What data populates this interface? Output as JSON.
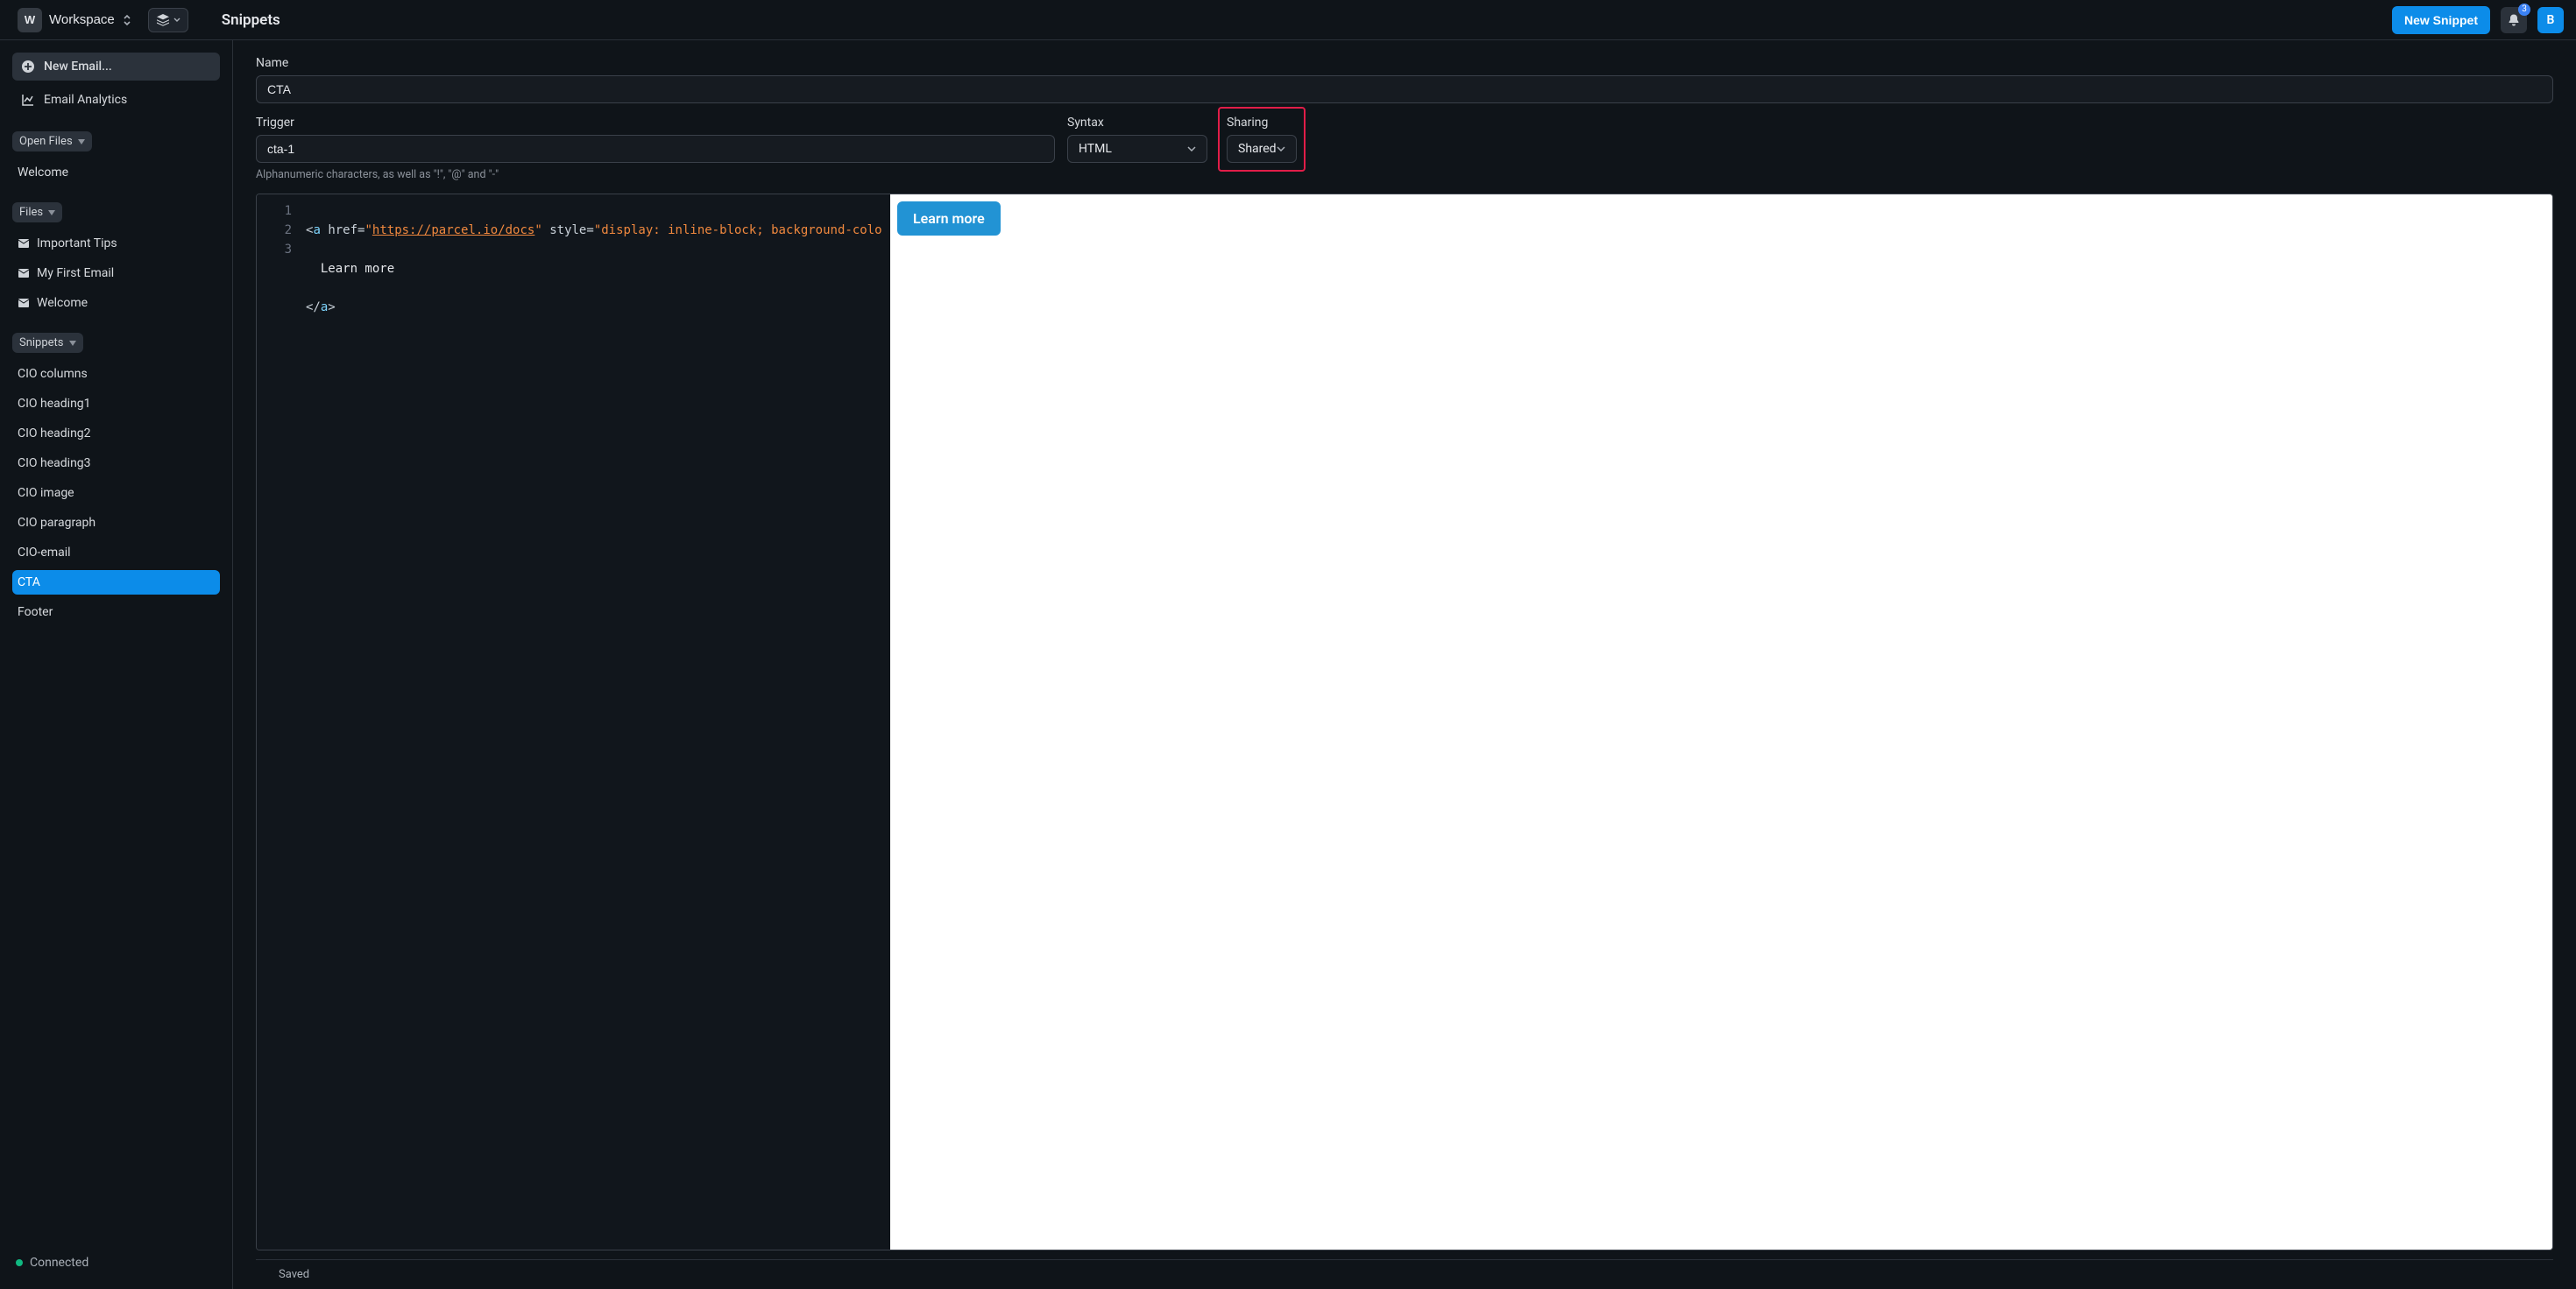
{
  "header": {
    "workspace_badge": "W",
    "workspace_name": "Workspace",
    "page_title": "Snippets",
    "new_snippet_label": "New Snippet",
    "notif_count": "3",
    "avatar_initial": "B"
  },
  "sidebar": {
    "new_email_label": "New Email...",
    "analytics_label": "Email Analytics",
    "open_files_header": "Open Files",
    "open_files": [
      {
        "label": "Welcome"
      }
    ],
    "files_header": "Files",
    "files": [
      {
        "label": "Important Tips"
      },
      {
        "label": "My First Email"
      },
      {
        "label": "Welcome"
      }
    ],
    "snippets_header": "Snippets",
    "snippets": [
      {
        "label": "CIO columns"
      },
      {
        "label": "CIO heading1"
      },
      {
        "label": "CIO heading2"
      },
      {
        "label": "CIO heading3"
      },
      {
        "label": "CIO image"
      },
      {
        "label": "CIO paragraph"
      },
      {
        "label": "CIO-email"
      },
      {
        "label": "CTA"
      },
      {
        "label": "Footer"
      }
    ],
    "status_label": "Connected"
  },
  "form": {
    "name_label": "Name",
    "name_value": "CTA",
    "trigger_label": "Trigger",
    "trigger_value": "cta-1",
    "trigger_hint": "Alphanumeric characters, as well as \"!\", \"@\" and \"-\"",
    "syntax_label": "Syntax",
    "syntax_value": "HTML",
    "sharing_label": "Sharing",
    "sharing_value": "Shared"
  },
  "editor": {
    "line_numbers": [
      "1",
      "2",
      "3"
    ],
    "line1_prefix": "<",
    "line1_tag": "a",
    "line1_sp1": " ",
    "line1_attr_href": "href",
    "line1_eq": "=",
    "line1_q": "\"",
    "line1_url": "https://parcel.io/docs",
    "line1_sp2": " ",
    "line1_attr_style": "style",
    "line1_style_val": "display: inline-block; background-colo",
    "line2_text": "  Learn more",
    "line3_open": "</",
    "line3_tag": "a",
    "line3_close": ">"
  },
  "preview": {
    "button_label": "Learn more"
  },
  "footer": {
    "status": "Saved"
  }
}
